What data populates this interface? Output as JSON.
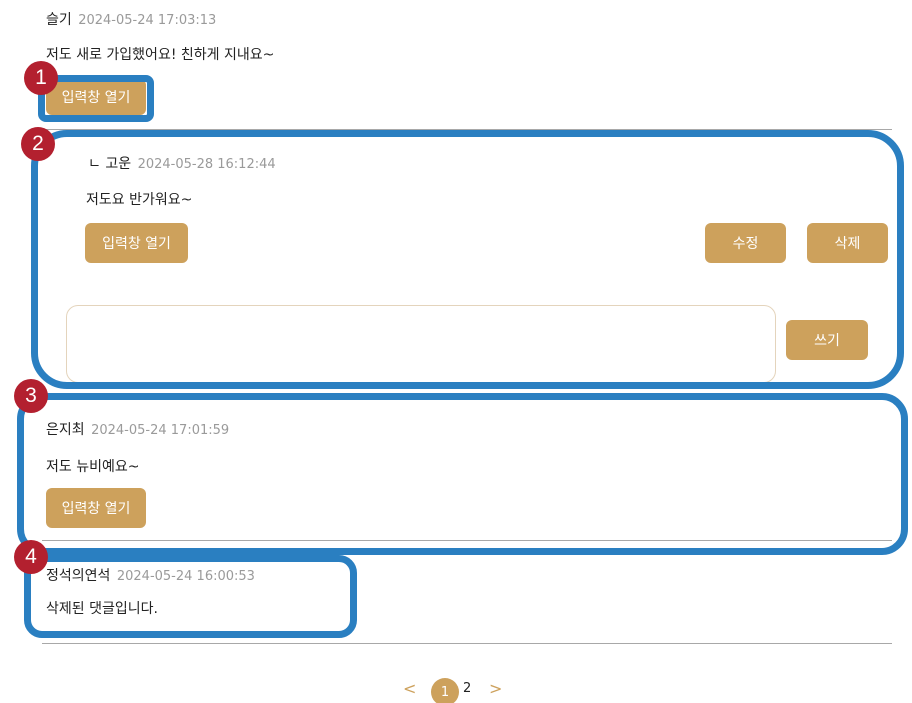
{
  "comments": [
    {
      "author": "슬기",
      "timestamp": "2024-05-24 17:03:13",
      "text": "저도 새로 가입했어요! 친하게 지내요~",
      "open_input_label": "입력창 열기"
    },
    {
      "reply_prefix": "ㄴ",
      "author": "고운",
      "timestamp": "2024-05-28 16:12:44",
      "text": "저도요 반가워요~",
      "open_input_label": "입력창 열기",
      "edit_label": "수정",
      "delete_label": "삭제",
      "reply_input_value": "",
      "write_label": "쓰기"
    },
    {
      "author": "은지최",
      "timestamp": "2024-05-24 17:01:59",
      "text": "저도 뉴비예요~",
      "open_input_label": "입력창 열기"
    },
    {
      "author": "정석의연석",
      "timestamp": "2024-05-24 16:00:53",
      "text": "삭제된 댓글입니다."
    }
  ],
  "markers": [
    "1",
    "2",
    "3",
    "4"
  ],
  "pagination": {
    "prev": "<",
    "current": "1",
    "pages": [
      "1",
      "2"
    ],
    "next": ">"
  },
  "colors": {
    "button": "#cda15c",
    "highlight": "#2a7fc1",
    "marker": "#b3202f",
    "timestamp": "#9a9a9a"
  }
}
